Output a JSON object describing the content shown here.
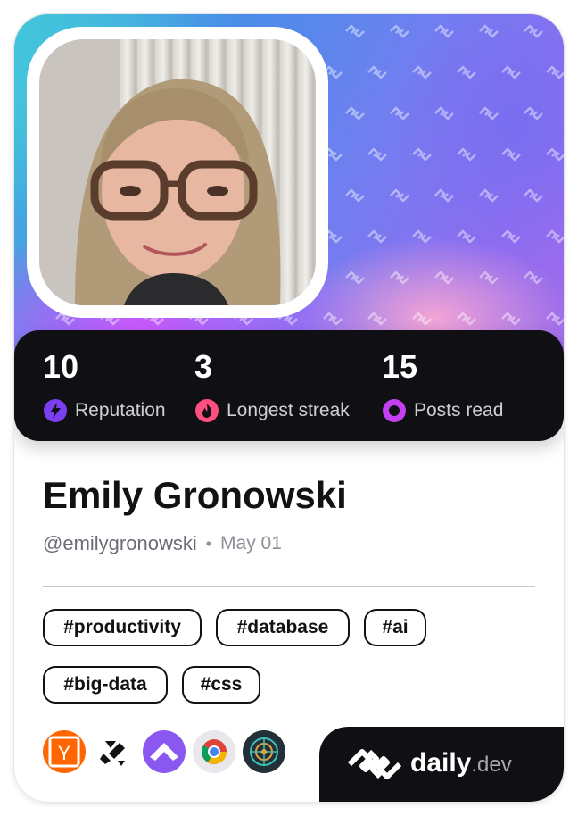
{
  "profile": {
    "name": "Emily Gronowski",
    "handle": "@emilygronowski",
    "separator": "•",
    "date": "May 01"
  },
  "stats": [
    {
      "value": "10",
      "label": "Reputation",
      "icon": "lightning-icon",
      "color": "#7b3ff2"
    },
    {
      "value": "3",
      "label": "Longest streak",
      "icon": "flame-icon",
      "color": "#ff4f80"
    },
    {
      "value": "15",
      "label": "Posts read",
      "icon": "eye-ring-icon",
      "color": "#c23ff2"
    }
  ],
  "tags": [
    "#productivity",
    "#database",
    "#ai",
    "#big-data",
    "#css"
  ],
  "sources": [
    {
      "icon": "hacker-news-icon",
      "letter": "Y",
      "color": "#ff6600"
    },
    {
      "icon": "dev-source-icon",
      "color": "#121214"
    },
    {
      "icon": "product-hunt-icon",
      "color": "#8a58f0"
    },
    {
      "icon": "chrome-icon",
      "color": "#e8e8ec"
    },
    {
      "icon": "ai-brain-icon",
      "color": "#22303a"
    }
  ],
  "brand": {
    "daily": "daily",
    "dev": ".dev"
  },
  "colors": {
    "card_dark": "#101014",
    "text_primary": "#121214",
    "text_muted": "#6b6c74"
  }
}
